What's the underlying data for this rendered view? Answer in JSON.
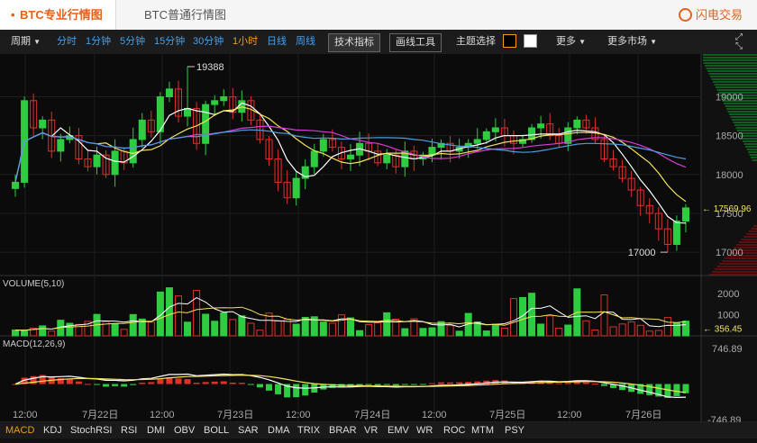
{
  "tabs": {
    "active": "BTC专业行情图",
    "second": "BTC普通行情图",
    "active_marker": "•"
  },
  "brand": {
    "name": "闪电交易"
  },
  "toolbar": {
    "period": "周期",
    "intervals": [
      "分时",
      "1分钟",
      "5分钟",
      "15分钟",
      "30分钟",
      "1小时",
      "日线",
      "周线"
    ],
    "active_interval": "1小时",
    "tech_indicator": "技术指标",
    "draw_tool": "画线工具",
    "theme_select": "主题选择",
    "more": "更多",
    "more_markets": "更多市场"
  },
  "price_axis": {
    "ticks": [
      "19000",
      "18500",
      "18000",
      "17500",
      "17000"
    ],
    "current": "17569.96",
    "high_label": "19388",
    "low_label": "17000"
  },
  "volume_panel": {
    "title": "VOLUME(5,10)",
    "ticks": [
      "2000",
      "1000"
    ],
    "current": "356.45"
  },
  "macd_panel": {
    "title": "MACD(12,26,9)",
    "ticks": [
      "746.89",
      "-746.89"
    ]
  },
  "time_axis": [
    "12:00",
    "7月22日",
    "12:00",
    "7月23日",
    "12:00",
    "7月24日",
    "12:00",
    "7月25日",
    "12:00",
    "7月26日"
  ],
  "indicators": [
    "MACD",
    "KDJ",
    "StochRSI",
    "RSI",
    "DMI",
    "OBV",
    "BOLL",
    "SAR",
    "DMA",
    "TRIX",
    "BRAR",
    "VR",
    "EMV",
    "WR",
    "ROC",
    "MTM",
    "PSY"
  ],
  "active_indicator": "MACD",
  "colors": {
    "up": "#2ecc40",
    "down": "#e0302a",
    "ma5": "#ffffff",
    "ma10": "#f5e35a",
    "ma20": "#d83bd6",
    "ma30": "#4a9fe6",
    "accent": "#e8611a"
  },
  "chart_data": {
    "type": "candlestick",
    "price_ticks": [
      19000,
      18500,
      18000,
      17500,
      17000
    ],
    "ylim": [
      16700,
      19550
    ],
    "current_price": 17569.96,
    "high": 19388,
    "low": 17000,
    "closes": [
      17900,
      18950,
      18600,
      18700,
      18300,
      18450,
      18500,
      18200,
      18100,
      18250,
      18000,
      18300,
      18150,
      18450,
      18700,
      18550,
      19000,
      19100,
      18750,
      18850,
      18400,
      18900,
      18950,
      19000,
      18800,
      18950,
      18700,
      18450,
      18200,
      17900,
      17700,
      17950,
      18100,
      18300,
      18450,
      18350,
      18200,
      18250,
      18400,
      18300,
      18150,
      18250,
      18100,
      18300,
      18200,
      18250,
      18350,
      18400,
      18300,
      18350,
      18400,
      18450,
      18550,
      18600,
      18500,
      18400,
      18450,
      18600,
      18650,
      18500,
      18400,
      18600,
      18700,
      18600,
      18450,
      18200,
      18100,
      17950,
      17800,
      17600,
      17500,
      17300,
      17100,
      17400,
      17570
    ],
    "volume_ticks": [
      2000,
      1000
    ],
    "volume_current": 356.45,
    "macd_range": [
      -746.89,
      746.89
    ]
  }
}
